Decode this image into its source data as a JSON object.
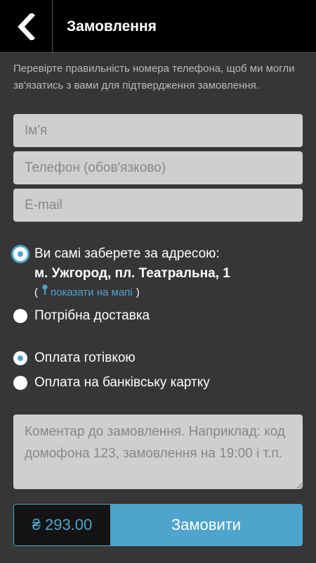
{
  "header": {
    "title": "Замовлення",
    "back_icon": "chevron-left-icon"
  },
  "info_text": "Перевірте правильність номера телефона, щоб ми могли зв'язатись з вами для підтвердження замовлення.",
  "form": {
    "name_placeholder": "Ім'я",
    "phone_placeholder": "Телефон (обов'язково)",
    "email_placeholder": "E-mail",
    "name_value": "",
    "phone_value": "",
    "email_value": ""
  },
  "delivery": {
    "pickup_label": "Ви самі заберете за адресою:",
    "pickup_checked": true,
    "address": "м. Ужгород, пл. Театральна, 1",
    "map_open_paren": "(",
    "map_link": "показати на мапі",
    "map_close_paren": ")",
    "delivery_label": "Потрібна доставка",
    "delivery_checked": false
  },
  "payment": {
    "cash_label": "Оплата готівкою",
    "cash_checked": true,
    "card_label": "Оплата на банківську картку",
    "card_checked": false
  },
  "comment": {
    "placeholder": "Коментар до замовлення. Наприклад: код домофона 123, замовлення на 19:00 і т.п.",
    "value": ""
  },
  "order": {
    "currency_symbol": "₴",
    "total": "293.00",
    "button_label": "Замовити"
  },
  "colors": {
    "accent": "#4fa4cd",
    "background": "#363636",
    "header": "#000000",
    "field": "#cfcfcf"
  }
}
